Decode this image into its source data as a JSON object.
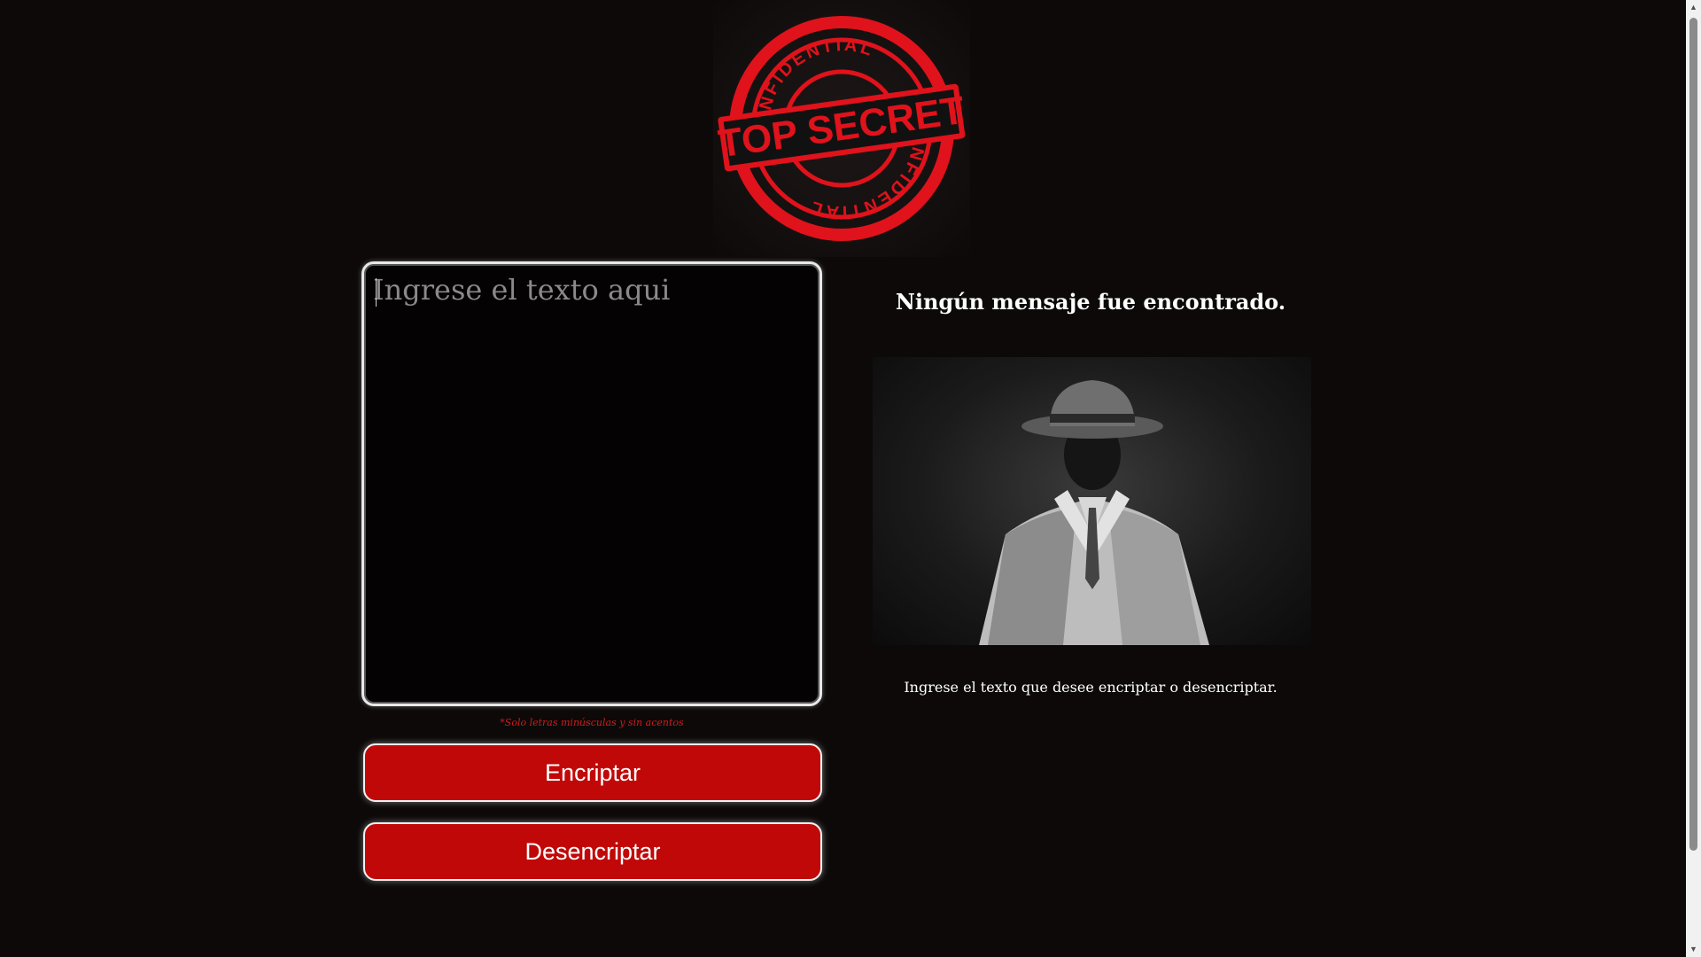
{
  "logo": {
    "stamp_text_top": "CONFIDENTIAL",
    "stamp_text_main": "TOP SECRET",
    "stamp_text_bottom": "CONFIDENTIAL",
    "stamp_color": "#e0121b"
  },
  "input": {
    "value": "",
    "placeholder": "Ingrese el texto aqui"
  },
  "hint": "*Solo letras minúsculas y sin acentos",
  "buttons": {
    "encrypt_label": "Encriptar",
    "decrypt_label": "Desencriptar"
  },
  "output": {
    "title": "Ningún mensaje fue encontrado.",
    "body": "Ingrese el texto que desee encriptar o desencriptar."
  },
  "colors": {
    "background": "#0d0909",
    "button": "#c10808",
    "hint": "#d21b1b"
  }
}
